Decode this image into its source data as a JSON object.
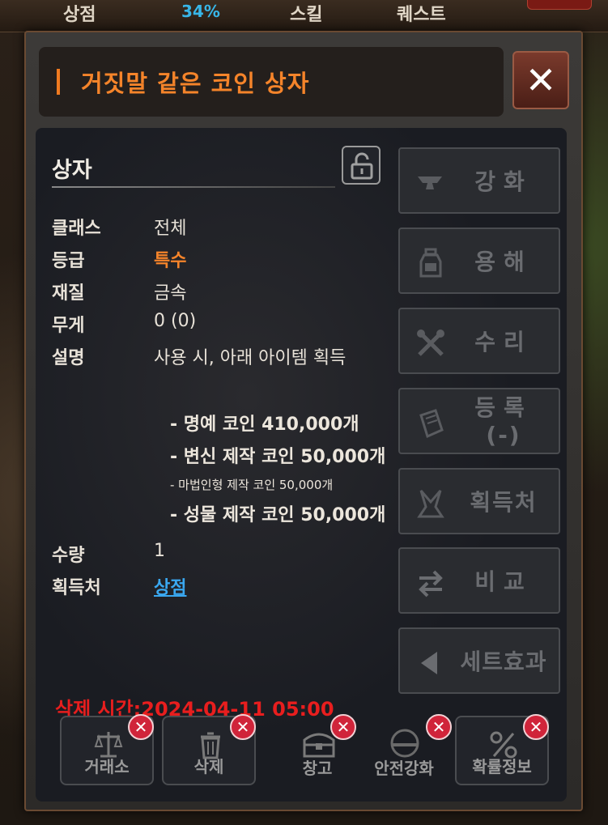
{
  "topbar": {
    "item1": "상점",
    "percent": "34%",
    "item2": "스킬",
    "item3": "퀘스트"
  },
  "window": {
    "title": "거짓말 같은 코인 상자",
    "close_label": "✕"
  },
  "info": {
    "section_title": "상자",
    "rows": [
      {
        "key": "클래스",
        "value": "전체"
      },
      {
        "key": "등급",
        "value": "특수"
      },
      {
        "key": "재질",
        "value": "금속"
      },
      {
        "key": "무게",
        "value": "0 (0)"
      },
      {
        "key": "설명",
        "value": "사용 시, 아래 아이템 획득"
      }
    ],
    "contents": [
      "- 명예 코인 410,000개",
      "- 변신 제작 코인 50,000개",
      "- 마법인형 제작 코인 50,000개",
      "- 성물 제작 코인 50,000개"
    ],
    "quantity_key": "수량",
    "quantity_value": "1",
    "source_key": "획득처",
    "source_value": "상점",
    "delete_time": "삭제 시간:2024-04-11 05:00"
  },
  "side_buttons": {
    "enhance": "강화",
    "dissolve": "용해",
    "repair": "수리",
    "register": "등록",
    "register_sub": "(-)",
    "source": "획득처",
    "compare": "비교",
    "set_effect": "세트효과"
  },
  "bottom_buttons": {
    "exchange": "거래소",
    "delete": "삭제",
    "warehouse": "창고",
    "safe_enhance": "안전강화",
    "probability": "확률정보"
  },
  "colors": {
    "title_orange": "#f5842a",
    "grade_orange": "#f5842a",
    "link_blue": "#3aa8f0",
    "delete_red": "#e81e1e",
    "disabled_text": "#6a6c70"
  }
}
